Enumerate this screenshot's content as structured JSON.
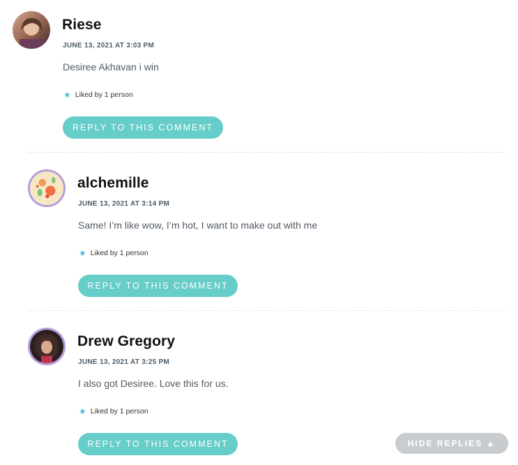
{
  "comments": [
    {
      "author": "Riese",
      "date": "JUNE 13, 2021 AT 3:03 PM",
      "text": "Desiree Akhavan i win",
      "liked": "Liked by 1 person",
      "reply_label": "REPLY TO THIS COMMENT"
    },
    {
      "author": "alchemille",
      "date": "JUNE 13, 2021 AT 3:14 PM",
      "text": "Same! I’m like wow, I’m hot, I want to make out with me",
      "liked": "Liked by 1 person",
      "reply_label": "REPLY TO THIS COMMENT"
    },
    {
      "author": "Drew Gregory",
      "date": "JUNE 13, 2021 AT 3:25 PM",
      "text": "I also got Desiree. Love this for us.",
      "liked": "Liked by 1 person",
      "reply_label": "REPLY TO THIS COMMENT"
    }
  ],
  "hide_replies_label": "HIDE REPLIES ▲",
  "colors": {
    "reply_button": "#66cdc9",
    "hide_button": "#c9cccf",
    "avatar_ring": "#b39ddb",
    "star": "#4fb7d6"
  },
  "icons": {
    "like": "star-icon",
    "hide": "triangle-up-icon"
  }
}
